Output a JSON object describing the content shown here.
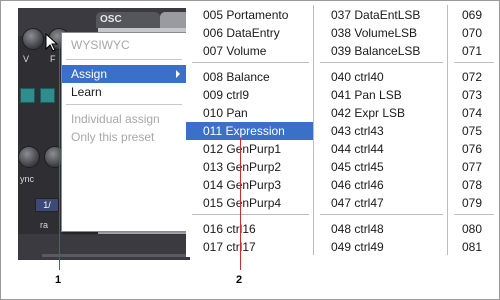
{
  "synth": {
    "osc_tab": "OSC",
    "labels": [
      "V",
      "F",
      "ync",
      "ra"
    ],
    "box_value": "1/"
  },
  "context_menu": {
    "items": [
      {
        "label": "WYSIWYC",
        "state": "disabled"
      },
      {
        "label": "Assign",
        "state": "selected",
        "has_submenu": true
      },
      {
        "label": "Learn",
        "state": "normal",
        "mnemonic": "L"
      },
      {
        "label": "Individual assign",
        "state": "disabled"
      },
      {
        "label": "Only this preset",
        "state": "disabled"
      }
    ]
  },
  "submenu": {
    "columns": [
      {
        "groups": [
          [
            "005 Portamento",
            "006 DataEntry",
            "007 Volume"
          ],
          [
            "008 Balance",
            "009 ctrl9",
            "010 Pan",
            "011 Expression",
            "012 GenPurp1",
            "013 GenPurp2",
            "014 GenPurp3",
            "015 GenPurp4"
          ],
          [
            "016 ctrl16",
            "017 ctrl17"
          ]
        ]
      },
      {
        "groups": [
          [
            "037 DataEntLSB",
            "038 VolumeLSB",
            "039 BalanceLSB"
          ],
          [
            "040 ctrl40",
            "041 Pan LSB",
            "042 Expr LSB",
            "043 ctrl43",
            "044 ctrl44",
            "045 ctrl45",
            "046 ctrl46",
            "047 ctrl47"
          ],
          [
            "048 ctrl48",
            "049 ctrl49"
          ]
        ]
      },
      {
        "groups": [
          [
            "069",
            "070",
            "071"
          ],
          [
            "072",
            "073",
            "074",
            "075",
            "076",
            "077",
            "078",
            "079"
          ],
          [
            "080",
            "081"
          ]
        ]
      }
    ],
    "selected": "011 Expression"
  },
  "callouts": [
    "1",
    "2"
  ],
  "colors": {
    "selection": "#3a70c8",
    "callout_line": "#c23030",
    "disabled_text": "#a8a8a8"
  }
}
